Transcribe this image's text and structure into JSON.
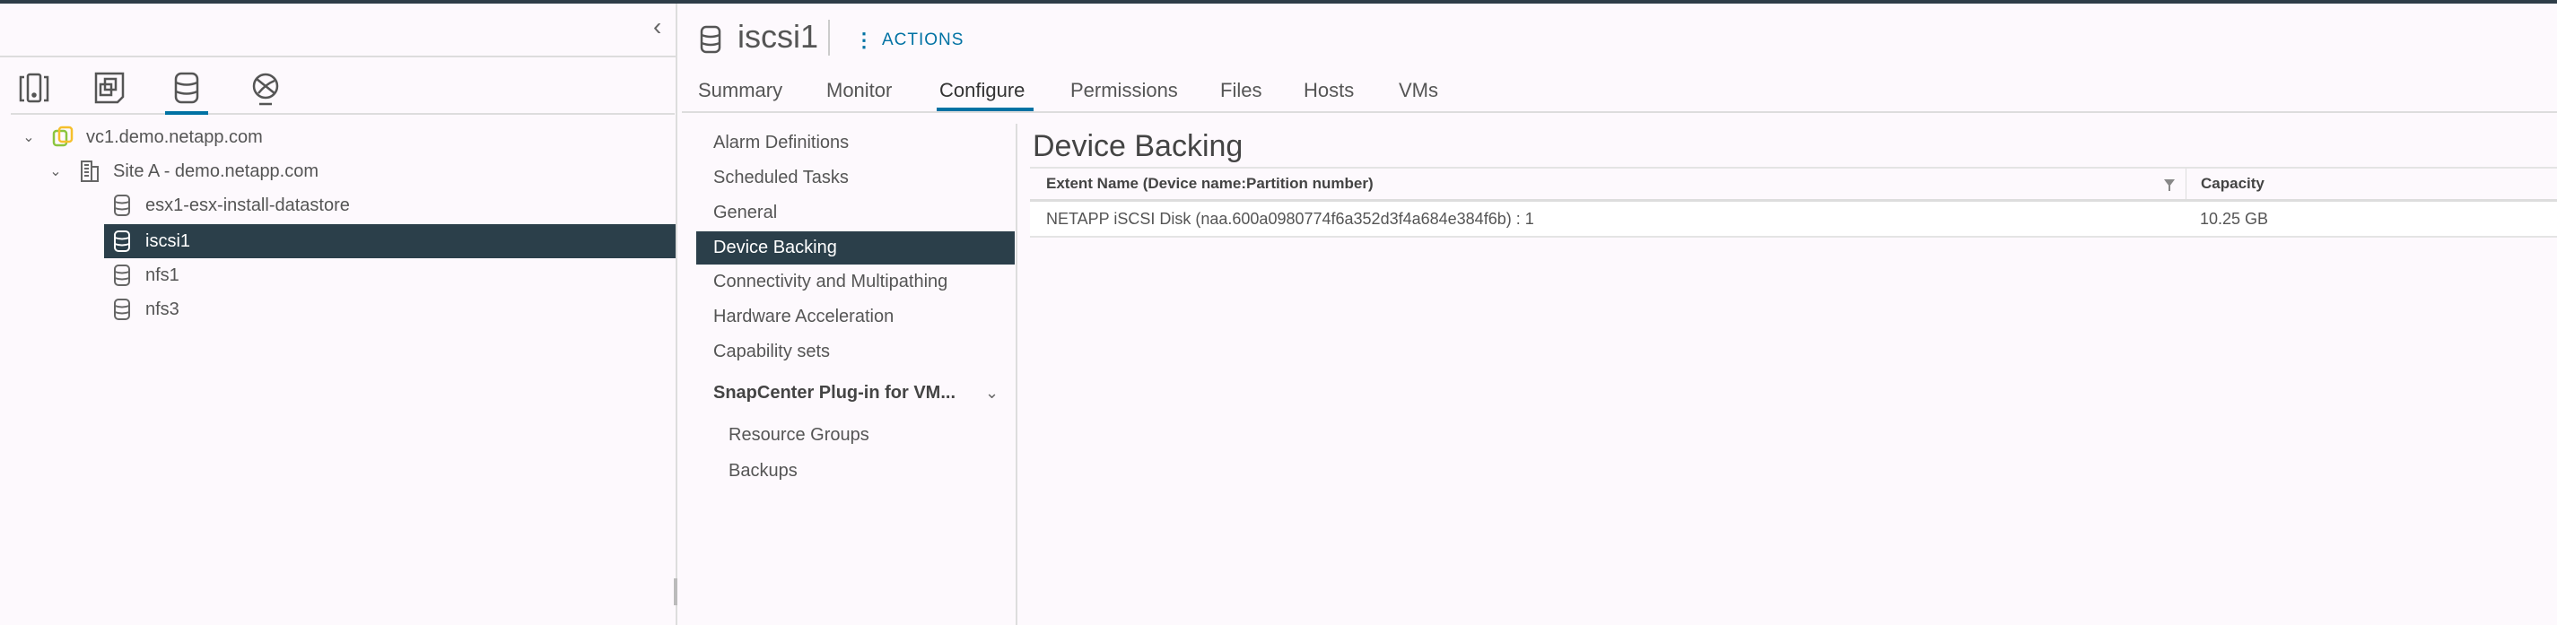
{
  "nav": {
    "collapse_icon": "chevron-left-icon",
    "view_tabs": [
      {
        "name": "hosts-clusters-icon"
      },
      {
        "name": "vms-templates-icon"
      },
      {
        "name": "storage-icon",
        "active": true
      },
      {
        "name": "networking-icon"
      }
    ],
    "tree": [
      {
        "label": "vc1.demo.netapp.com",
        "icon": "vcenter-icon",
        "level": 0,
        "expanded": true
      },
      {
        "label": "Site A - demo.netapp.com",
        "icon": "datacenter-icon",
        "level": 1,
        "expanded": true
      },
      {
        "label": "esx1-esx-install-datastore",
        "icon": "datastore-icon",
        "level": 2
      },
      {
        "label": "iscsi1",
        "icon": "datastore-icon",
        "level": 2,
        "selected": true
      },
      {
        "label": "nfs1",
        "icon": "datastore-icon",
        "level": 2
      },
      {
        "label": "nfs3",
        "icon": "datastore-icon",
        "level": 2
      }
    ]
  },
  "header": {
    "title": "iscsi1",
    "actions_label": "ACTIONS"
  },
  "tabs": [
    "Summary",
    "Monitor",
    "Configure",
    "Permissions",
    "Files",
    "Hosts",
    "VMs"
  ],
  "active_tab": "Configure",
  "config_menu": {
    "items": [
      "Alarm Definitions",
      "Scheduled Tasks",
      "General",
      "Device Backing",
      "Connectivity and Multipathing",
      "Hardware Acceleration",
      "Capability sets"
    ],
    "selected": "Device Backing",
    "group": "SnapCenter Plug-in for VM...",
    "group_items": [
      "Resource Groups",
      "Backups"
    ]
  },
  "content": {
    "title": "Device Backing",
    "columns": [
      "Extent Name (Device name:Partition number)",
      "Capacity"
    ],
    "rows": [
      [
        "NETAPP iSCSI Disk (naa.600a0980774f6a352d3f4a684e384f6b) : 1",
        "10.25 GB"
      ]
    ]
  },
  "colors": {
    "accent": "#0072a3",
    "selected": "#2b3f4a",
    "background": "#fdf9fd"
  }
}
